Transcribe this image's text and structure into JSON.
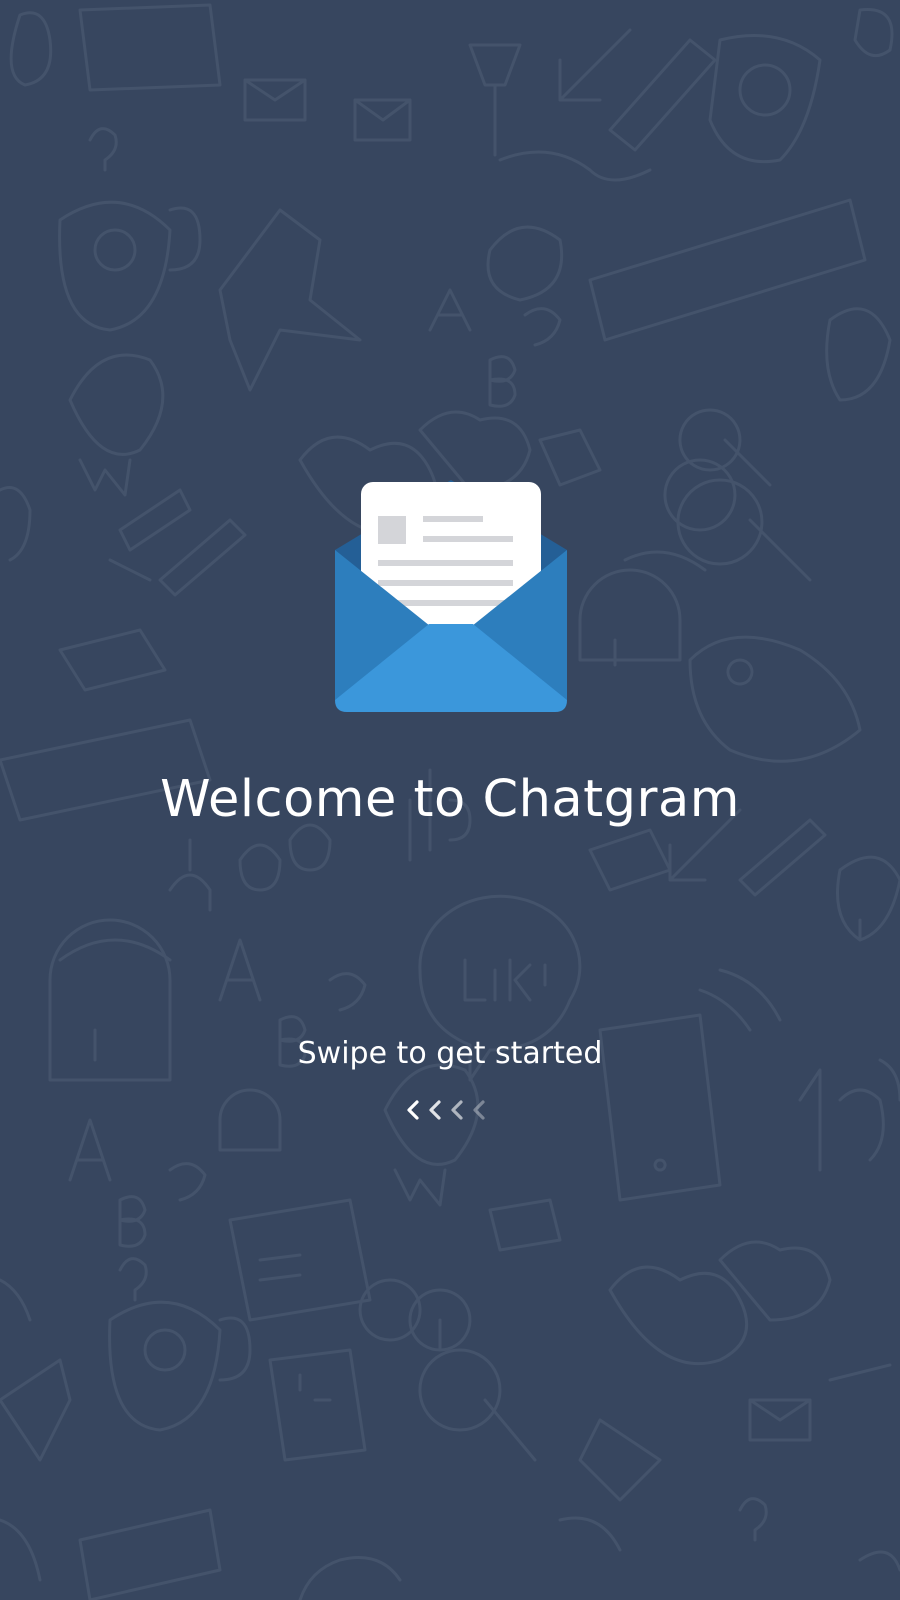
{
  "app": {
    "title": "Welcome to Chatgram",
    "subtitle": "Swipe to get started"
  },
  "icons": {
    "logo": "open-envelope-icon",
    "swipe_indicator": "chevron-left-icon"
  },
  "colors": {
    "background": "#37465f",
    "doodle": "#44536b",
    "envelope_light": "#3b97db",
    "envelope_dark": "#2d7ebd",
    "envelope_back": "#245f96",
    "letter": "#ffffff",
    "letter_lines": "#d4d5d9",
    "text": "#ffffff"
  },
  "swipe_indicator": {
    "count": 4,
    "opacities": [
      1,
      0.85,
      0.6,
      0.35
    ]
  }
}
